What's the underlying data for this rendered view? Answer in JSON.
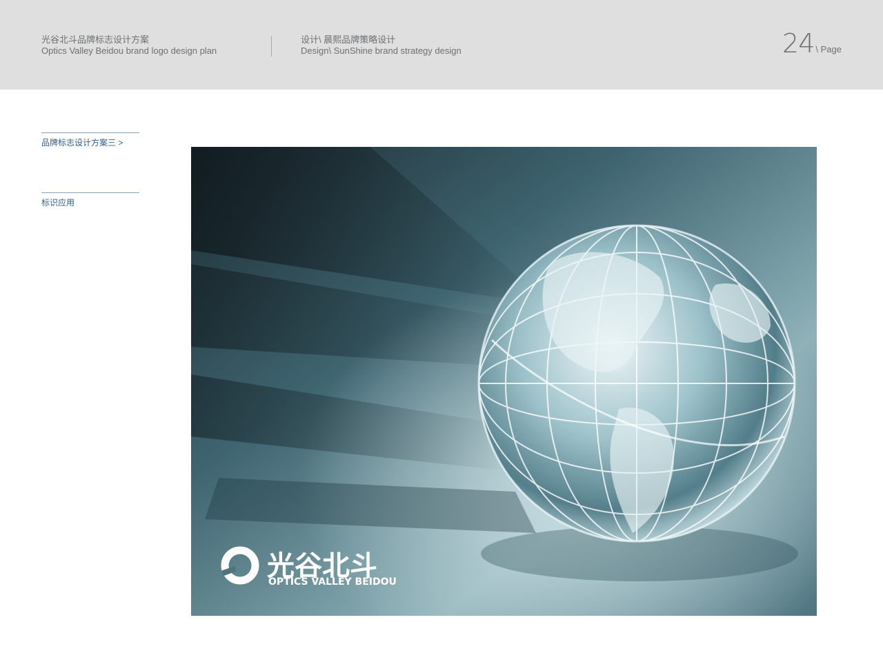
{
  "header": {
    "left_cn": "光谷北斗品牌标志设计方案",
    "left_en": "Optics Valley Beidou brand logo design plan",
    "mid_cn": "设计\\ 晨熙品牌策略设计",
    "mid_en": "Design\\ SunShine brand strategy design",
    "page_number": "24",
    "page_label": "\\ Page"
  },
  "sidebar": {
    "items": [
      {
        "label": "品牌标志设计方案三 >"
      },
      {
        "label": "标识应用"
      }
    ]
  },
  "main": {
    "logo_cn": "光谷北斗",
    "logo_en": "OPTICS VALLEY BEIDOU"
  }
}
